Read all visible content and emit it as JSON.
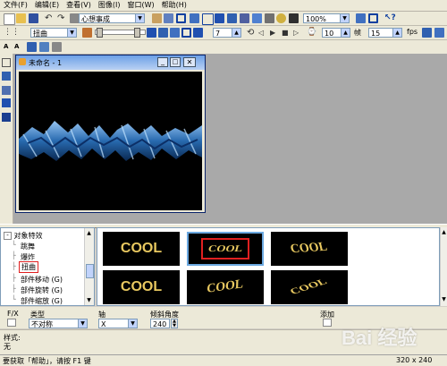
{
  "menu": [
    "文件(F)",
    "编辑(E)",
    "查看(V)",
    "图像(I)",
    "窗口(W)",
    "帮助(H)"
  ],
  "toolbar1": {
    "style_combo": "心想事成",
    "zoom_combo": "100%"
  },
  "toolbar2": {
    "effect_combo": "扭曲",
    "frame_value": "7",
    "frames_value": "10",
    "frames_label": "帧",
    "fps_value": "15",
    "fps_label": "fps"
  },
  "document": {
    "title": "未命名 - 1"
  },
  "tree": {
    "root": "对象特效",
    "items": [
      "跳舞",
      "爆炸",
      "扭曲",
      "部件移动 (G)",
      "部件旋转 (G)",
      "部件缩放 (G)"
    ],
    "selected_index": 2
  },
  "gallery": {
    "thumbs": [
      "COOL",
      "COOL",
      "COOL",
      "COOL",
      "COOL",
      "COOL"
    ],
    "highlight_index": 1
  },
  "props": {
    "fx_label": "F/X",
    "type_label": "类型",
    "type_value": "不对称",
    "axis_label": "轴",
    "axis_value": "X",
    "angle_label": "倾斜角度",
    "angle_value": "240",
    "add_label": "添加"
  },
  "style": {
    "label": "样式:",
    "value": "无"
  },
  "status": {
    "help_text": "要获取「帮助」，请按 F1 键",
    "size": "320 x 240"
  },
  "watermark": "Bai 经验",
  "colors": {
    "accent_red": "#e02020",
    "title_blue": "#6ca0e6",
    "gold": "#d8b850"
  }
}
